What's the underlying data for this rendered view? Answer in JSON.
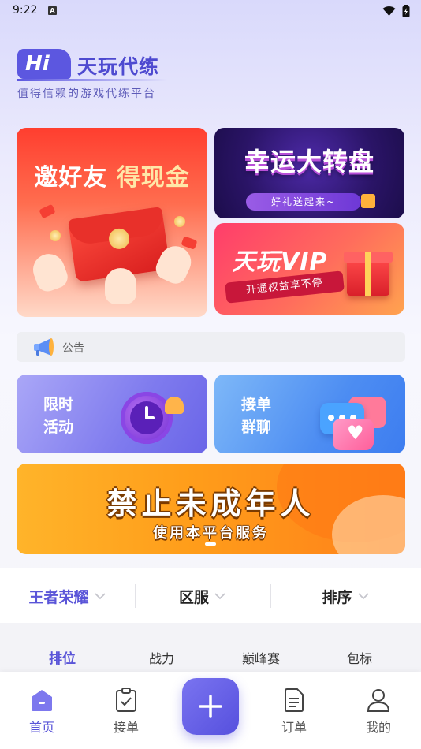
{
  "status_bar": {
    "time": "9:22",
    "a_badge": "A"
  },
  "header": {
    "logo_badge": "Hi",
    "app_name": "天玩代练",
    "slogan": "值得信赖的游戏代练平台"
  },
  "banners": {
    "invite": {
      "title_part1": "邀好友",
      "title_part2": "得现金"
    },
    "wheel": {
      "title": "幸运大转盘",
      "subtitle": "好礼送起来~"
    },
    "vip": {
      "title": "天玩VIP",
      "subtitle": "开通权益享不停"
    },
    "minor": {
      "title": "禁止未成年人",
      "subtitle": "使用本平台服务"
    }
  },
  "notice": {
    "label": "公告"
  },
  "cards": {
    "activity": {
      "line1": "限时",
      "line2": "活动"
    },
    "group": {
      "line1": "接单",
      "line2": "群聊"
    }
  },
  "filters": {
    "game": "王者荣耀",
    "zone": "区服",
    "sort": "排序"
  },
  "sub_tabs": [
    "排位",
    "战力",
    "巅峰赛",
    "包标"
  ],
  "active_sub_tab": "排位",
  "bottom_nav": [
    {
      "label": "首页",
      "icon": "home-icon",
      "active": true
    },
    {
      "label": "接单",
      "icon": "take-order-icon",
      "active": false
    },
    {
      "label": "订单",
      "icon": "order-list-icon",
      "active": false
    },
    {
      "label": "我的",
      "icon": "profile-icon",
      "active": false
    }
  ],
  "colors": {
    "brand": "#5a55d8",
    "invite_red": "#ff3e2f",
    "wheel_purple": "#2a1466",
    "vip_pink": "#ff3d6b",
    "minor_orange": "#ff9d1a"
  }
}
